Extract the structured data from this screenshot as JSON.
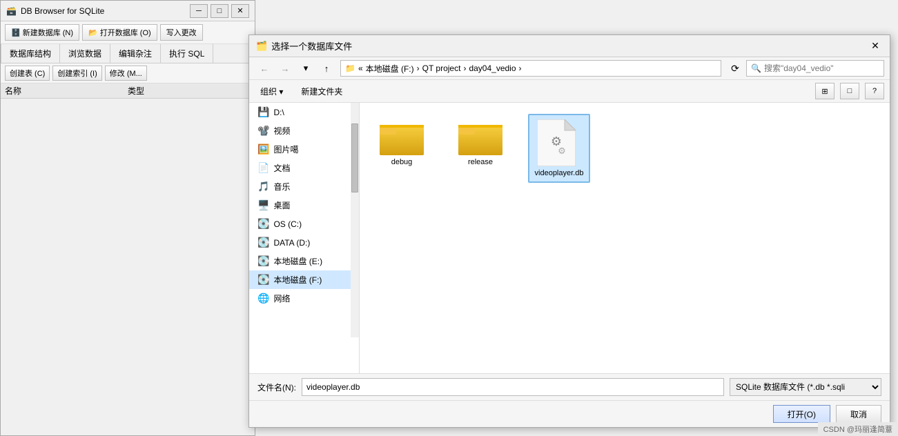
{
  "app": {
    "title": "DB Browser for SQLite",
    "icon": "🗃️"
  },
  "app_toolbar": {
    "new_db": "新建数据库 (N)",
    "open_db": "打开数据库 (O)",
    "write_changes": "写入更改",
    "new_db_icon": "🗄️",
    "open_db_icon": "📂"
  },
  "app_tabs": [
    "数据库结构",
    "浏览数据",
    "编辑杂注",
    "执行 SQL"
  ],
  "app_sub_toolbar": {
    "create_table": "创建表 (C)",
    "create_index": "创建索引 (I)",
    "modify": "修改 (M..."
  },
  "app_table_header": {
    "name": "名称",
    "type": "类型"
  },
  "dialog": {
    "title": "选择一个数据库文件",
    "icon": "🗂️",
    "close": "✕"
  },
  "navbar": {
    "back": "‹",
    "forward": "›",
    "up": "↑",
    "breadcrumb": [
      "本地磁盘 (F:)",
      "QT project",
      "day04_vedio"
    ],
    "breadcrumb_sep": "›",
    "refresh": "⟳",
    "search_placeholder": "搜索\"day04_vedio\"",
    "search_icon": "🔍"
  },
  "dialog_toolbar": {
    "organize": "组织 ▾",
    "new_folder": "新建文件夹",
    "view_icon1": "⊞",
    "view_icon2": "□",
    "help_icon": "?"
  },
  "sidebar": {
    "items": [
      {
        "label": "D:\\",
        "icon": "💾"
      },
      {
        "label": "视频",
        "icon": "📽️"
      },
      {
        "label": "图片噶",
        "icon": "🖼️"
      },
      {
        "label": "文档",
        "icon": "📄"
      },
      {
        "label": "音乐",
        "icon": "🎵"
      },
      {
        "label": "桌面",
        "icon": "🖥️"
      },
      {
        "label": "OS (C:)",
        "icon": "💽"
      },
      {
        "label": "DATA (D:)",
        "icon": "💽"
      },
      {
        "label": "本地磁盘 (E:)",
        "icon": "💽"
      },
      {
        "label": "本地磁盘 (F:)",
        "icon": "💽",
        "active": true
      },
      {
        "label": "网络",
        "icon": "🌐"
      }
    ]
  },
  "files": [
    {
      "name": "debug",
      "type": "folder",
      "selected": false
    },
    {
      "name": "release",
      "type": "folder",
      "selected": false
    },
    {
      "name": "videoplayer.db",
      "type": "db",
      "selected": true
    }
  ],
  "bottom": {
    "filename_label": "文件名(N):",
    "filename_value": "videoplayer.db",
    "filetype_value": "SQLite 数据库文件 (*.db *.sqli",
    "open_btn": "打开(O)",
    "cancel_btn": "取消"
  },
  "watermark": {
    "text": "CSDN  @玛丽逢简薏"
  }
}
